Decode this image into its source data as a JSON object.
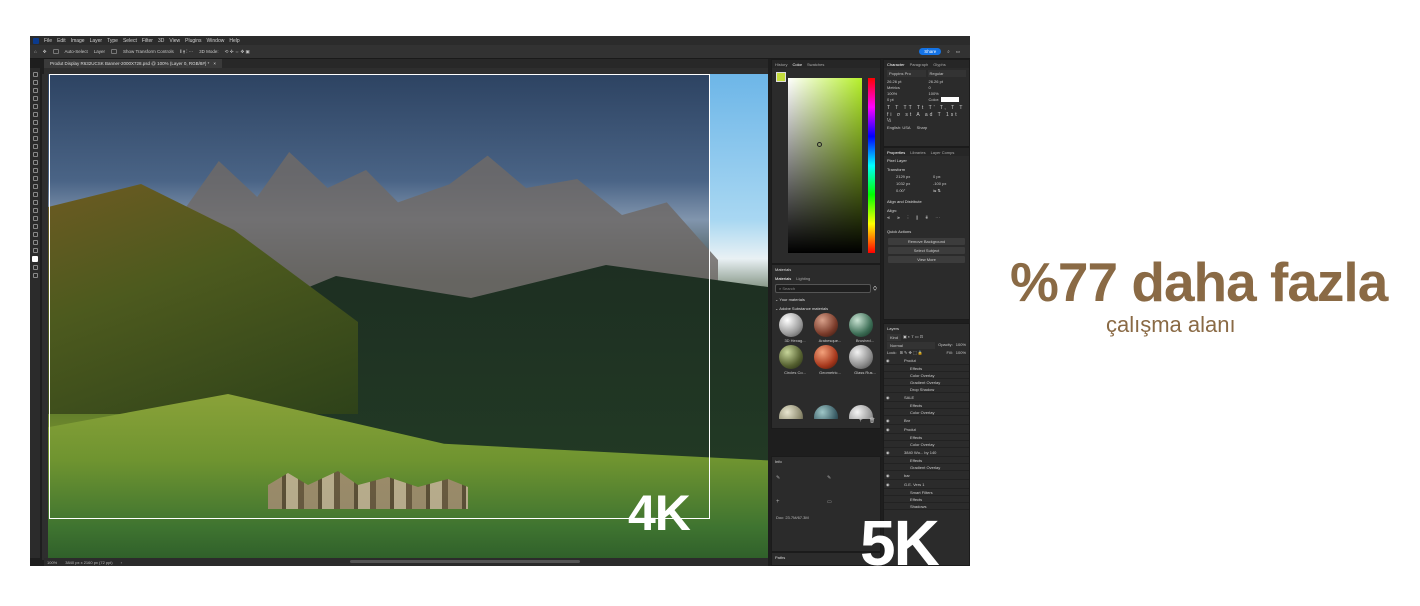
{
  "app": {
    "menus": [
      "File",
      "Edit",
      "Image",
      "Layer",
      "Type",
      "Select",
      "Filter",
      "3D",
      "View",
      "Plugins",
      "Window",
      "Help"
    ],
    "options": {
      "auto_select": "Auto-Select",
      "layer_select": "Layer",
      "show_transform": "Show Transform Controls",
      "mode_3d": "3D Mode:",
      "share": "Share"
    },
    "document_tab": "Produt Display R632UCSK Banner-2000X728.psd @ 100% (Layer 0, RGB/8#) *",
    "status": {
      "zoom": "100%",
      "size": "3840 px x 2160 px (72 ppi)"
    }
  },
  "canvas": {
    "label_4k": "4K",
    "label_5k": "5K"
  },
  "panels": {
    "history_tabs": [
      "History",
      "Color",
      "Swatches"
    ],
    "materials": {
      "title": "Materials",
      "tabs": [
        "Materials",
        "Lighting"
      ],
      "search_placeholder": "Search",
      "your_materials": "Your materials",
      "substance": "Adobe Substance materials",
      "items": [
        {
          "label": "3D Hexag..."
        },
        {
          "label": "Arabesque..."
        },
        {
          "label": "Brushed..."
        },
        {
          "label": "Circles Co..."
        },
        {
          "label": "Geometric..."
        },
        {
          "label": "Glass Rus..."
        }
      ]
    },
    "info": {
      "title": "Info",
      "doc": "Doc: 23.7M/67.3M"
    },
    "paths": "Paths",
    "character": {
      "tabs": [
        "Character",
        "Paragraph",
        "Glyphs"
      ],
      "font": "Poppins Pro",
      "style": "Regular",
      "size": "26.26 pt",
      "leading": "26.26 pt",
      "kerning": "Metrics",
      "scale_v": "100%",
      "scale_h": "100%",
      "baseline": "0 pt",
      "color_label": "Color:",
      "language": "English: USA",
      "aa": "Sharp"
    },
    "properties": {
      "tabs": [
        "Properties",
        "Libraries",
        "Layer Comps"
      ],
      "pixel_layer": "Pixel Layer",
      "transform": "Transform",
      "w": "2129 px",
      "h": "1032 px",
      "x": "0 px",
      "y": "-100 px",
      "angle": "0.00°",
      "align": "Align and Distribute",
      "align_sub": "Align:",
      "quick": "Quick Actions",
      "remove_bg": "Remove Background",
      "select_subject": "Select Subject",
      "view_more": "View More"
    },
    "layers": {
      "title": "Layers",
      "kind": "Kind",
      "blend": "Normal",
      "opacity_label": "Opacity:",
      "opacity": "100%",
      "lock_label": "Lock:",
      "fill_label": "Fill:",
      "fill": "100%",
      "items": [
        {
          "name": "Produt",
          "sub": false
        },
        {
          "name": "Effects",
          "sub": true
        },
        {
          "name": "Color Overlay",
          "sub": true
        },
        {
          "name": "Gradient Overlay",
          "sub": true
        },
        {
          "name": "Drop Shadow",
          "sub": true
        },
        {
          "name": "SALE",
          "sub": false
        },
        {
          "name": "Effects",
          "sub": true
        },
        {
          "name": "Color Overlay",
          "sub": true
        },
        {
          "name": "Bnr",
          "sub": false
        },
        {
          "name": "Produt",
          "sub": false
        },
        {
          "name": "Effects",
          "sub": true
        },
        {
          "name": "Color Overlay",
          "sub": true
        },
        {
          "name": "3840 Wo... by 140",
          "sub": false
        },
        {
          "name": "Effects",
          "sub": true
        },
        {
          "name": "Gradient Overlay",
          "sub": true
        },
        {
          "name": "bar",
          "sub": false
        },
        {
          "name": "G.E. Vers 1",
          "sub": false
        },
        {
          "name": "Smart Filters",
          "sub": true
        },
        {
          "name": "Effects",
          "sub": true
        },
        {
          "name": "Shadows",
          "sub": true
        }
      ]
    }
  },
  "headline": {
    "main": "%77 daha fazla",
    "sub": "çalışma alanı"
  },
  "colors": {
    "accent": "#8a6a45",
    "share": "#1473e6"
  }
}
